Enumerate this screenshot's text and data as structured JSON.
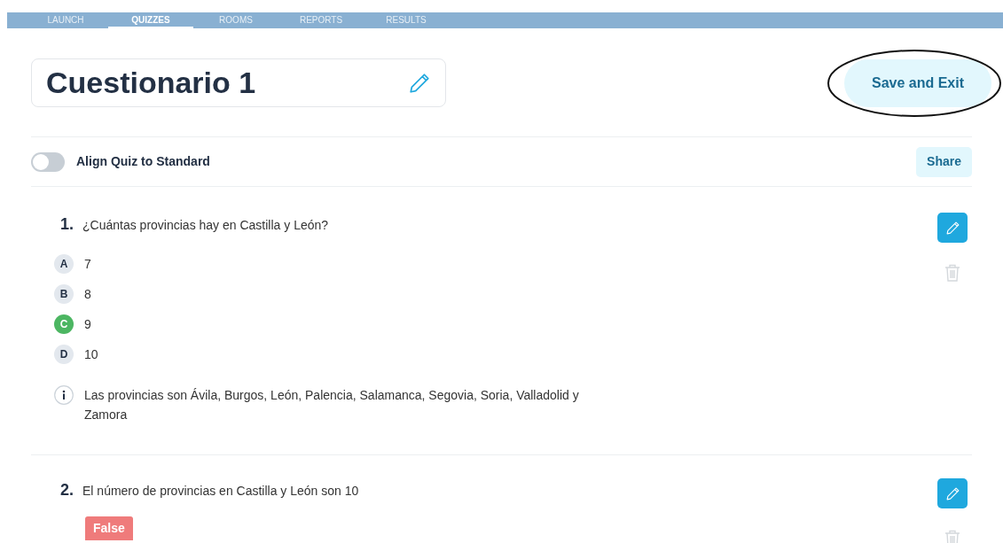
{
  "nav": {
    "tabs": [
      {
        "label": "LAUNCH",
        "selected": false
      },
      {
        "label": "QUIZZES",
        "selected": true
      },
      {
        "label": "ROOMS",
        "selected": false
      },
      {
        "label": "REPORTS",
        "selected": false
      },
      {
        "label": "RESULTS",
        "selected": false
      }
    ]
  },
  "quiz": {
    "title": "Cuestionario 1",
    "save_button": "Save and Exit",
    "align_toggle": {
      "label": "Align Quiz to Standard",
      "on": false
    },
    "share_button": "Share"
  },
  "questions": [
    {
      "kind": "multiple_choice",
      "number": "1.",
      "text": "¿Cuántas provincias hay en Castilla y León?",
      "options": [
        {
          "letter": "A",
          "text": "7",
          "correct": false
        },
        {
          "letter": "B",
          "text": "8",
          "correct": false
        },
        {
          "letter": "C",
          "text": "9",
          "correct": true
        },
        {
          "letter": "D",
          "text": "10",
          "correct": false
        }
      ],
      "explanation": "Las provincias son Ávila, Burgos, León, Palencia, Salamanca, Segovia, Soria, Valladolid y Zamora"
    },
    {
      "kind": "true_false",
      "number": "2.",
      "text": "El número de provincias en Castilla y León son 10",
      "answer": "False"
    }
  ]
}
